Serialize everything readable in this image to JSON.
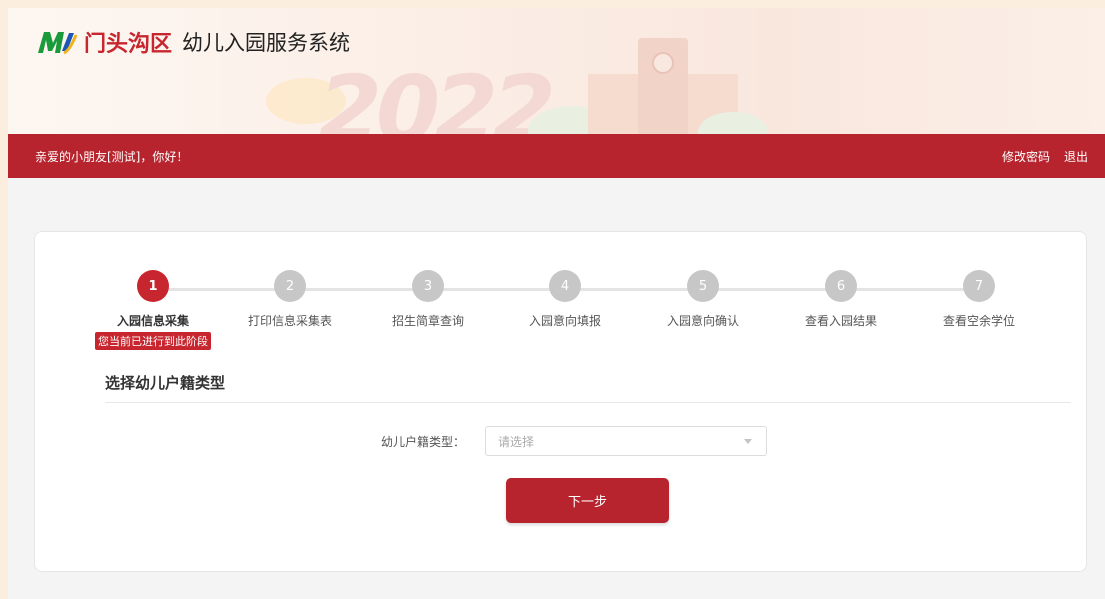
{
  "header": {
    "district": "门头沟区",
    "system_name": "幼儿入园服务系统",
    "banner_deco": "2022"
  },
  "topbar": {
    "greeting": "亲爱的小朋友[测试]，你好！",
    "change_password": "修改密码",
    "logout": "退出"
  },
  "steps": [
    {
      "number": "1",
      "label": "入园信息采集",
      "active": true,
      "badge": "您当前已进行到此阶段"
    },
    {
      "number": "2",
      "label": "打印信息采集表",
      "active": false
    },
    {
      "number": "3",
      "label": "招生简章查询",
      "active": false
    },
    {
      "number": "4",
      "label": "入园意向填报",
      "active": false
    },
    {
      "number": "5",
      "label": "入园意向确认",
      "active": false
    },
    {
      "number": "6",
      "label": "查看入园结果",
      "active": false
    },
    {
      "number": "7",
      "label": "查看空余学位",
      "active": false
    }
  ],
  "form": {
    "section_title": "选择幼儿户籍类型",
    "field_label": "幼儿户籍类型：",
    "select_placeholder": "请选择",
    "next_button": "下一步"
  },
  "colors": {
    "brand_red": "#b8242d",
    "active_step": "#c8262e",
    "inactive_step": "#c7c7c7"
  }
}
